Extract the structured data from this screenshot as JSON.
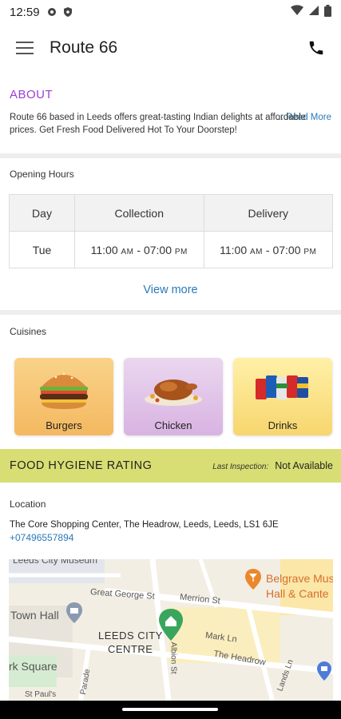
{
  "status": {
    "time": "12:59"
  },
  "appbar": {
    "title": "Route 66"
  },
  "about": {
    "heading": "ABOUT",
    "text": "Route 66 based in Leeds offers great-tasting Indian delights at affordable prices. Get Fresh Food Delivered Hot To Your Doorstep!",
    "read_more": "... Read More"
  },
  "hours": {
    "label": "Opening Hours",
    "headers": [
      "Day",
      "Collection",
      "Delivery"
    ],
    "row": {
      "day": "Tue",
      "collection_open": "11:00",
      "collection_close": "07:00",
      "delivery_open": "11:00",
      "delivery_close": "07:00",
      "am": "AM",
      "pm": "PM",
      "sep": "-"
    },
    "view_more": "View more"
  },
  "cuisines": {
    "label": "Cuisines",
    "items": [
      {
        "label": "Burgers",
        "icon": "burger-icon"
      },
      {
        "label": "Chicken",
        "icon": "roast-chicken-icon"
      },
      {
        "label": "Drinks",
        "icon": "soda-cans-icon"
      }
    ]
  },
  "hygiene": {
    "title": "FOOD HYGIENE RATING",
    "inspection_label": "Last Inspection:",
    "inspection_value": "Not Available"
  },
  "location": {
    "label": "Location",
    "address": "The Core Shopping Center, The Headrow, Leeds, Leeds, LS1 6JE",
    "phone": "+07496557894"
  },
  "map": {
    "labels": {
      "museum": "Leeds City Museum",
      "george": "Great George St",
      "merrion": "Merrion St",
      "belgrave": "Belgrave Mus",
      "hall": "Hall & Cante",
      "townhall": "Town Hall",
      "centre1": "LEEDS CITY",
      "centre2": "CENTRE",
      "markln": "Mark Ln",
      "albion": "Albion St",
      "headrow": "The Headrow",
      "square": "rk Square",
      "parade": "Parade",
      "stpauls": "St Paul's",
      "lands": "Lands Ln"
    }
  },
  "colors": {
    "accent_purple": "#9b3fd1",
    "link_blue": "#2a7ab8",
    "hygiene_bg": "#d8de73"
  }
}
